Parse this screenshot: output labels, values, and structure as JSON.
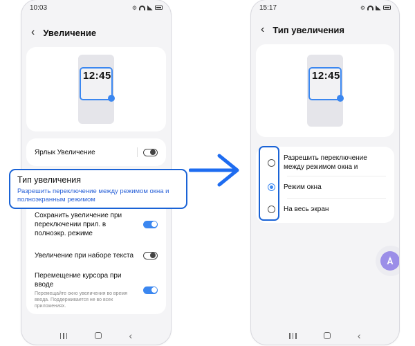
{
  "left_screen": {
    "status": {
      "time": "10:03"
    },
    "title": "Увеличение",
    "preview_clock": "12:45",
    "shortcut_label": "Ярлык Увеличение",
    "shortcut_on": false,
    "settings": [
      {
        "label": "Сохранить увеличение при переключении прил. в полноэкр. режиме",
        "on": true
      },
      {
        "label": "Увеличение при наборе текста",
        "on": false
      },
      {
        "label": "Перемещение курсора при вводе",
        "description": "Перемещайте окно увеличения во время ввода. Поддерживается не во всех приложениях.",
        "on": true
      }
    ]
  },
  "callout": {
    "title": "Тип увеличения",
    "subtitle": "Разрешить переключение между режимом окна и полноэкранным режимом"
  },
  "right_screen": {
    "status": {
      "time": "15:17"
    },
    "title": "Тип увеличения",
    "preview_clock": "12:45",
    "options": [
      {
        "label": "Разрешить переключение между режимом окна и",
        "checked": false
      },
      {
        "label": "Режим окна",
        "checked": true
      },
      {
        "label": "На весь экран",
        "checked": false
      }
    ],
    "fab_icon": "accessibility-icon"
  },
  "colors": {
    "accent": "#3b87f0",
    "highlight": "#1a63d6",
    "link": "#2a62d8"
  }
}
